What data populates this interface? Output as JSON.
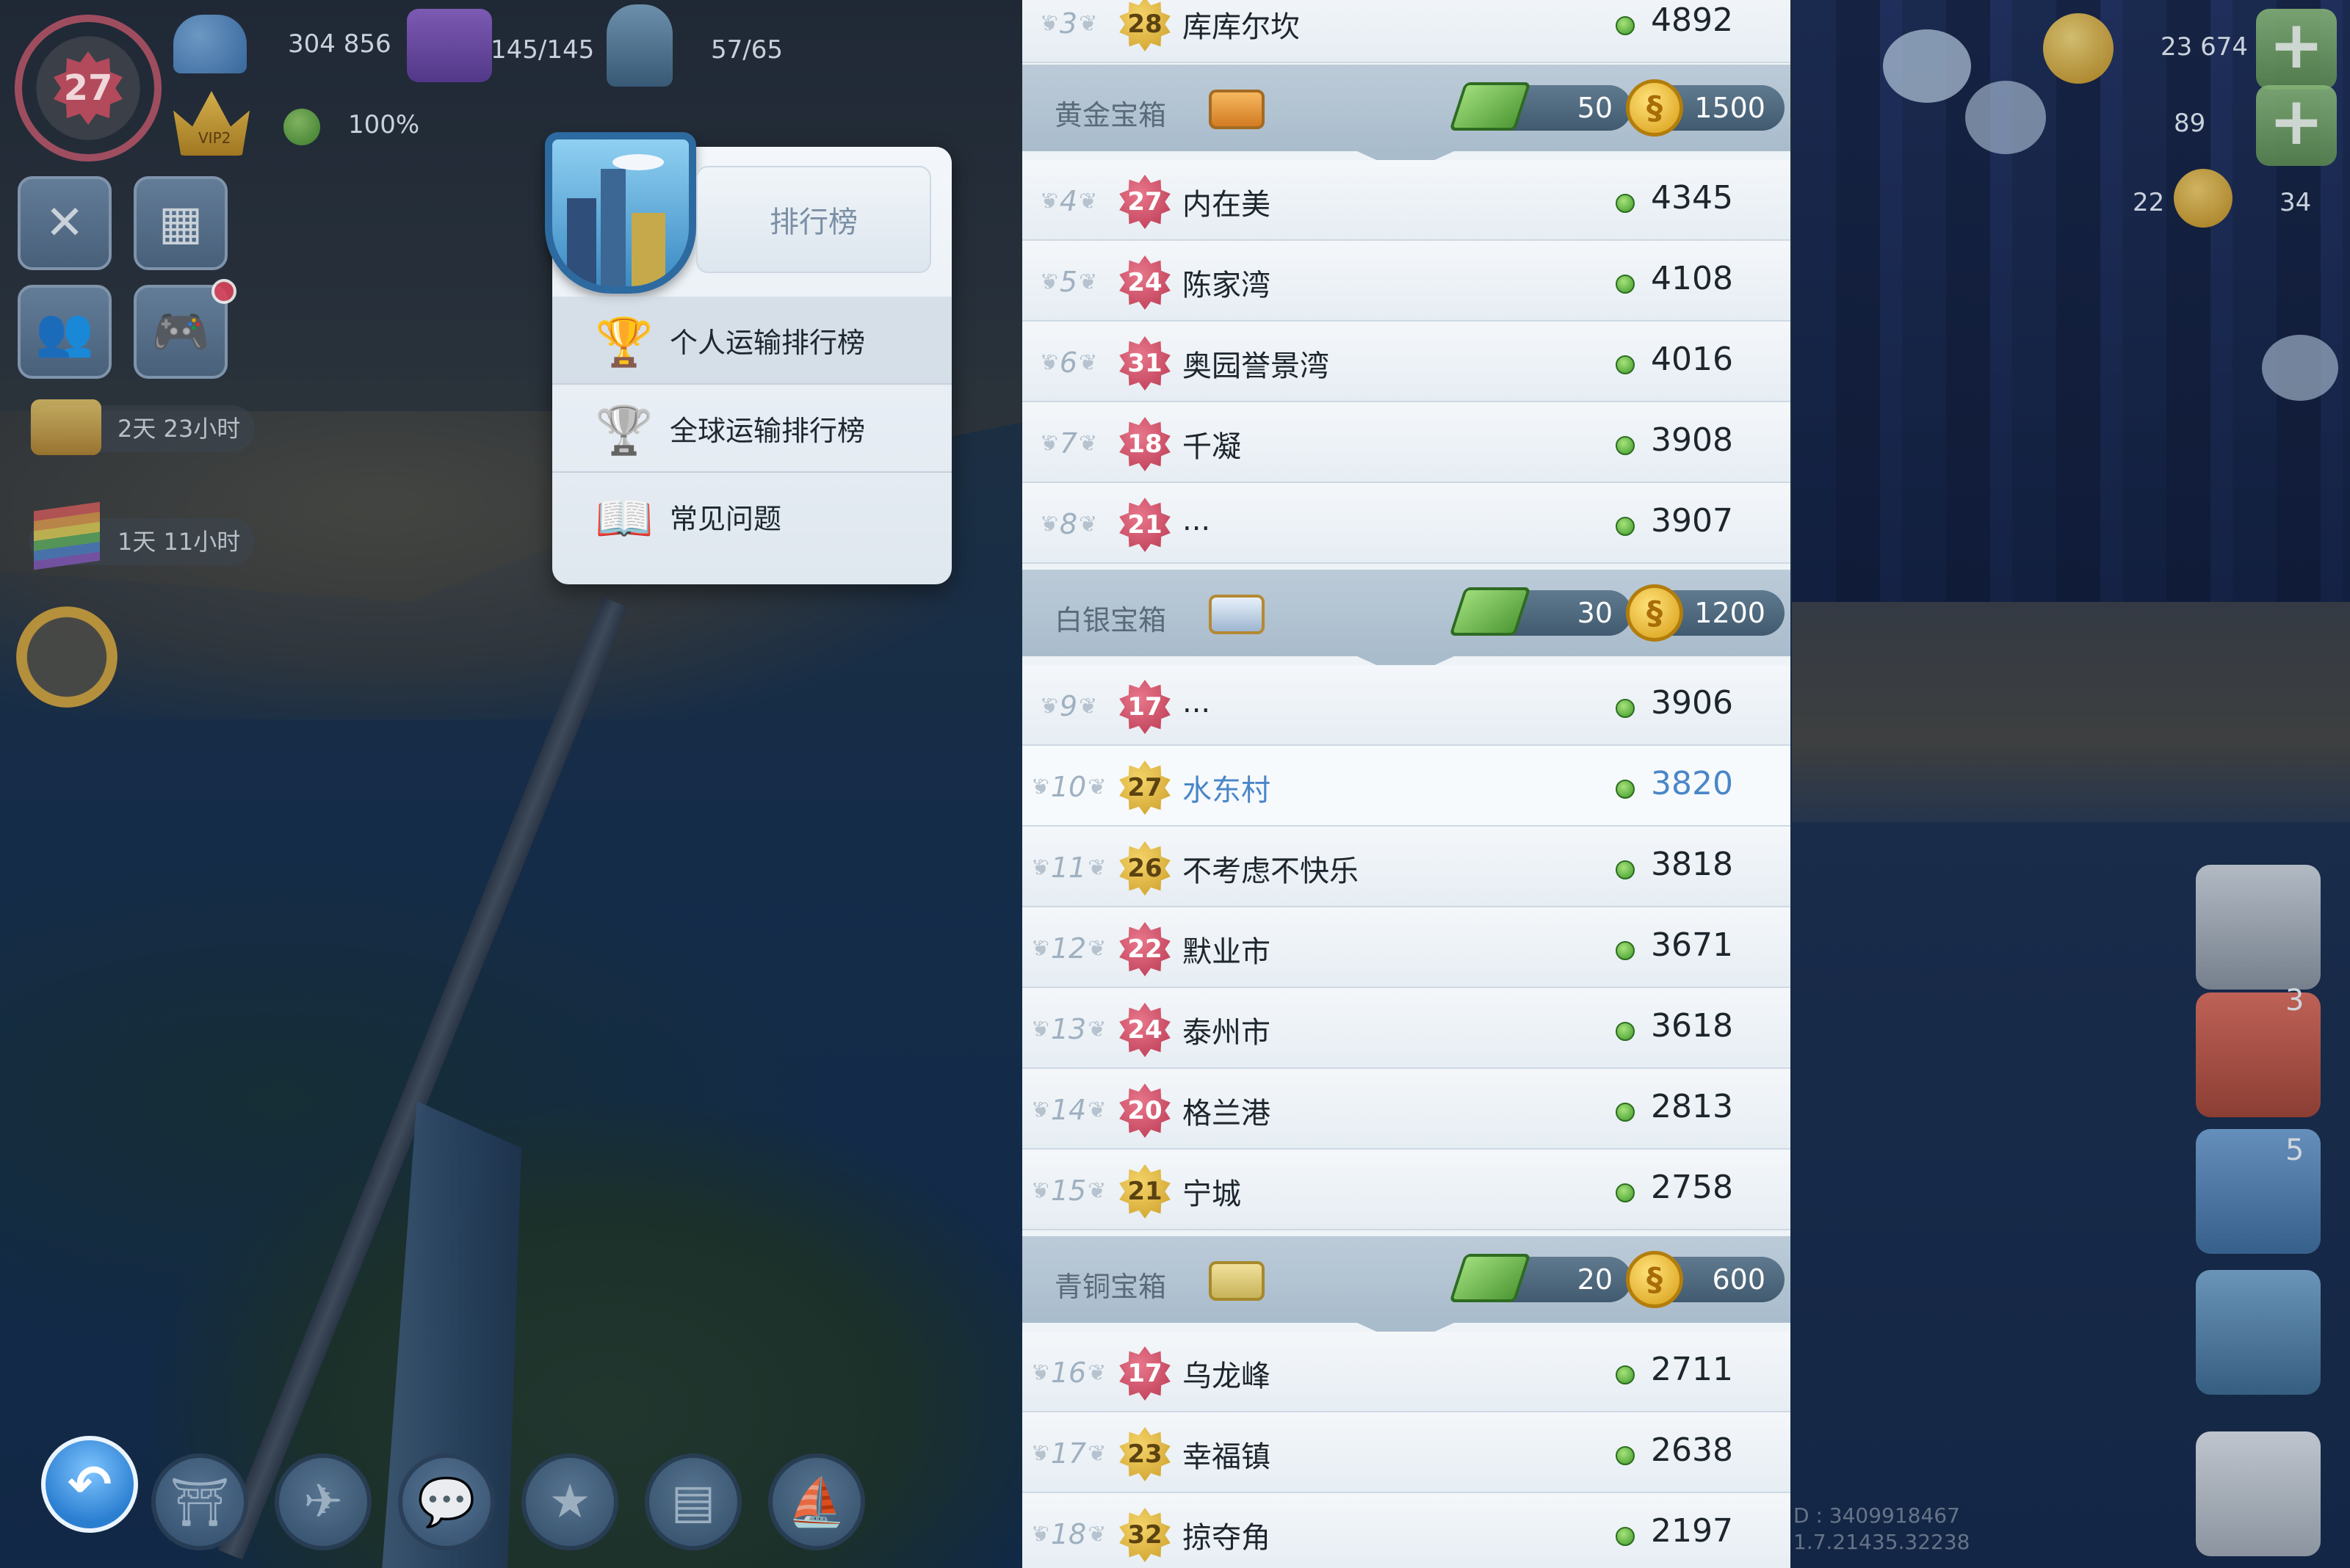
{
  "hud": {
    "level": "27",
    "population": "304 856",
    "storage": "145/145",
    "water": "57/65",
    "happiness": "100%",
    "vip": "VIP2",
    "timer1": "2天 23小时",
    "timer2": "1天 11小时",
    "simoleons": "23 674",
    "simcash": "89",
    "keys_a": "22",
    "keys_b": "34",
    "build_count_1": "3",
    "build_count_2": "5",
    "id_line1": "D : 3409918467",
    "id_line2": "1.7.21435.32238"
  },
  "menu": {
    "title": "排行榜",
    "items": [
      {
        "label": "个人运输排行榜",
        "icon": "gold-trophy-icon"
      },
      {
        "label": "全球运输排行榜",
        "icon": "silver-trophy-icon"
      },
      {
        "label": "常见问题",
        "icon": "faq-book-icon"
      }
    ]
  },
  "leaderboard": {
    "top_row": {
      "rank": "3",
      "level": "28",
      "city": "库库尔坎",
      "score": "4892"
    },
    "tiers": [
      {
        "name": "黄金宝箱",
        "chest": "gold-chest-icon",
        "cash": "50",
        "coins": "1500",
        "rows": [
          {
            "rank": "4",
            "level": "27",
            "city": "内在美",
            "score": "4345",
            "badge": "red"
          },
          {
            "rank": "5",
            "level": "24",
            "city": "陈家湾",
            "score": "4108",
            "badge": "red"
          },
          {
            "rank": "6",
            "level": "31",
            "city": "奥园誉景湾",
            "score": "4016",
            "badge": "red"
          },
          {
            "rank": "7",
            "level": "18",
            "city": "千凝",
            "score": "3908",
            "badge": "red"
          },
          {
            "rank": "8",
            "level": "21",
            "city": "...",
            "score": "3907",
            "badge": "red"
          }
        ]
      },
      {
        "name": "白银宝箱",
        "chest": "silver-chest-icon",
        "cash": "30",
        "coins": "1200",
        "rows": [
          {
            "rank": "9",
            "level": "17",
            "city": "...",
            "score": "3906",
            "badge": "red"
          },
          {
            "rank": "10",
            "level": "27",
            "city": "水东村",
            "score": "3820",
            "badge": "gold",
            "highlight": true
          },
          {
            "rank": "11",
            "level": "26",
            "city": "不考虑不快乐",
            "score": "3818",
            "badge": "gold"
          },
          {
            "rank": "12",
            "level": "22",
            "city": "默业市",
            "score": "3671",
            "badge": "red"
          },
          {
            "rank": "13",
            "level": "24",
            "city": "泰州市",
            "score": "3618",
            "badge": "red"
          },
          {
            "rank": "14",
            "level": "20",
            "city": "格兰港",
            "score": "2813",
            "badge": "red"
          },
          {
            "rank": "15",
            "level": "21",
            "city": "宁城",
            "score": "2758",
            "badge": "gold"
          }
        ]
      },
      {
        "name": "青铜宝箱",
        "chest": "bronze-chest-icon",
        "cash": "20",
        "coins": "600",
        "rows": [
          {
            "rank": "16",
            "level": "17",
            "city": "乌龙峰",
            "score": "2711",
            "badge": "red"
          },
          {
            "rank": "17",
            "level": "23",
            "city": "幸福镇",
            "score": "2638",
            "badge": "gold"
          },
          {
            "rank": "18",
            "level": "32",
            "city": "掠夺角",
            "score": "2197",
            "badge": "gold"
          }
        ]
      }
    ]
  },
  "colors": {
    "highlight_text": "#4a86c8",
    "tier_bg": "#a9bccc",
    "row_bg": "#eef3f7"
  }
}
